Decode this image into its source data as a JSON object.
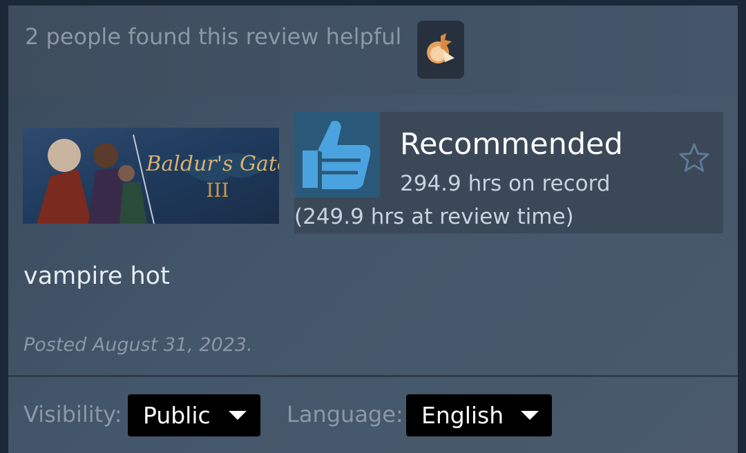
{
  "helpful": {
    "text": "2 people found this review helpful",
    "award_icon": "award-icon"
  },
  "game": {
    "name": "Baldur's Gate",
    "numeral": "III"
  },
  "recommendation": {
    "title": "Recommended",
    "hours_on_record": "294.9 hrs on record",
    "hours_at_review": "(249.9 hrs at review time)",
    "icon": "thumbs-up-icon",
    "favorite_icon": "star-icon"
  },
  "review": {
    "text": "vampire hot",
    "posted": "Posted August 31, 2023."
  },
  "footer": {
    "visibility_label": "Visibility:",
    "visibility_value": "Public",
    "language_label": "Language:",
    "language_value": "English"
  },
  "colors": {
    "background": "#1b2838",
    "thumb_blue": "#4aa3df",
    "dropdown": "#000000"
  }
}
